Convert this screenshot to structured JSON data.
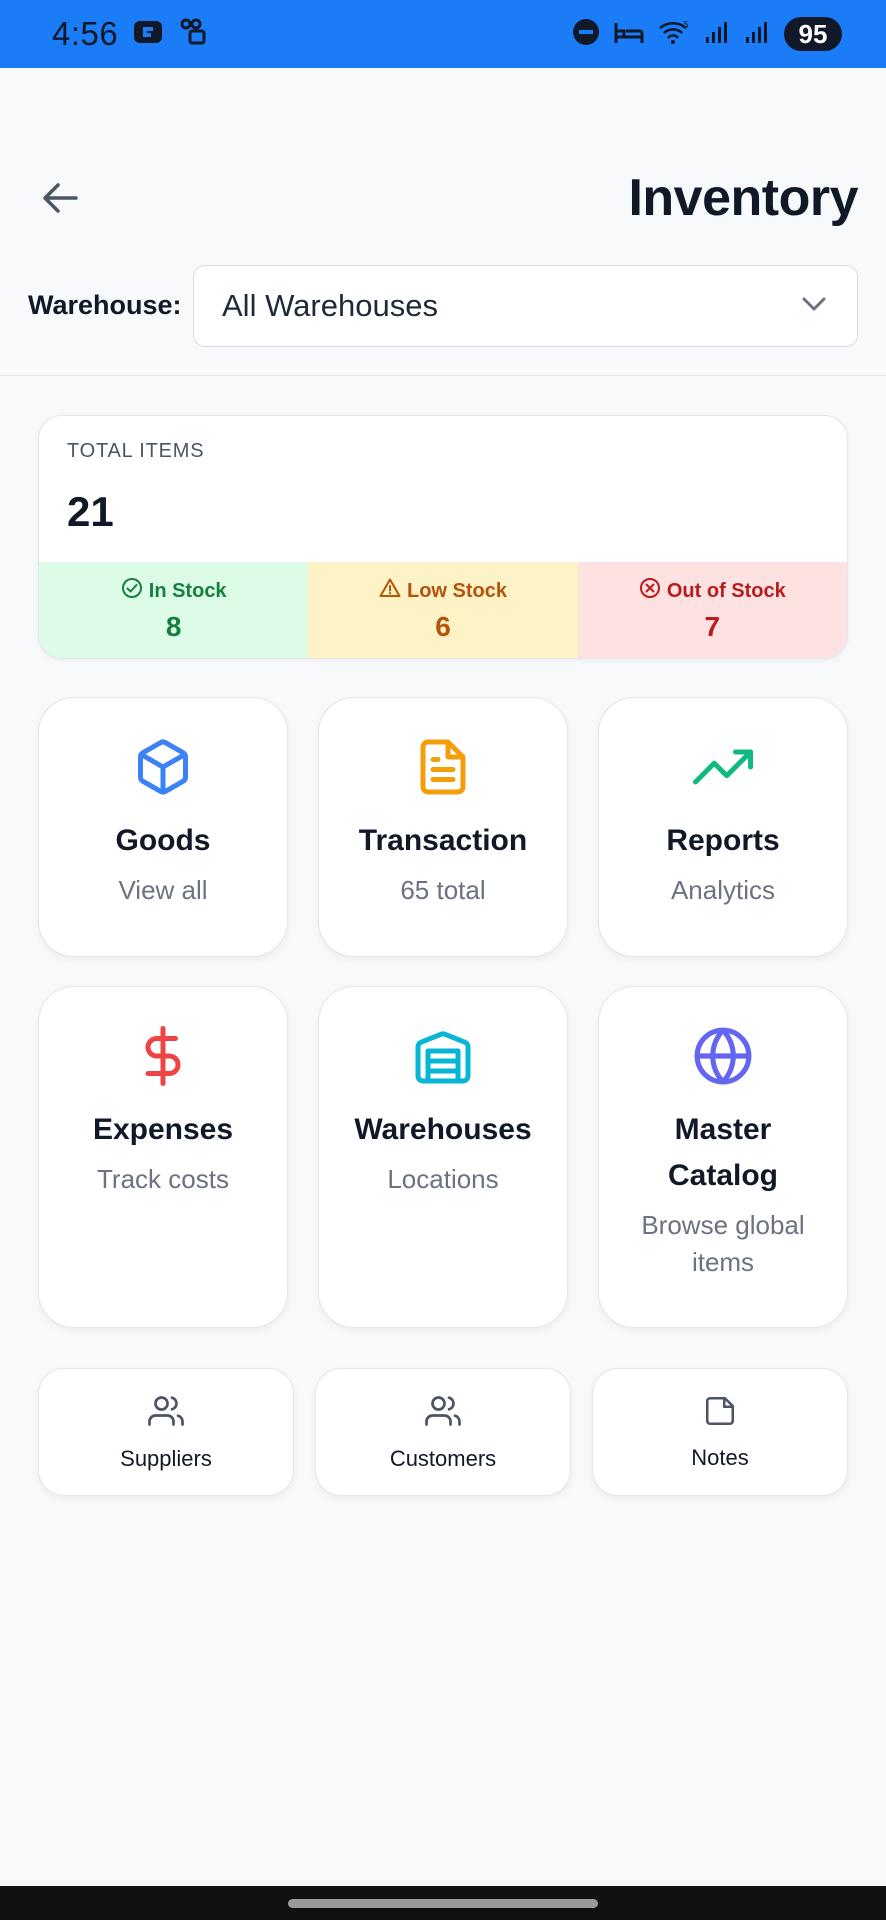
{
  "status_bar": {
    "time": "4:56",
    "battery": "95",
    "bg_color": "#1a7cf6"
  },
  "header": {
    "title": "Inventory",
    "back_icon": "arrow-left-icon",
    "warehouse_label": "Warehouse:",
    "warehouse_selected": "All Warehouses"
  },
  "summary": {
    "total_label": "TOTAL ITEMS",
    "total_value": "21",
    "in_stock": {
      "label": "In Stock",
      "count": "8",
      "color": "#15803d"
    },
    "low_stock": {
      "label": "Low Stock",
      "count": "6",
      "color": "#b45309"
    },
    "out_of_stock": {
      "label": "Out of Stock",
      "count": "7",
      "color": "#b91c1c"
    }
  },
  "tiles": [
    {
      "title": "Goods",
      "subtitle": "View all",
      "icon": "box-icon",
      "color": "#3b82f6"
    },
    {
      "title": "Transaction",
      "subtitle": "65 total",
      "icon": "document-icon",
      "color": "#f59e0b"
    },
    {
      "title": "Reports",
      "subtitle": "Analytics",
      "icon": "trending-up-icon",
      "color": "#10b981"
    },
    {
      "title": "Expenses",
      "subtitle": "Track costs",
      "icon": "dollar-icon",
      "color": "#ef4444"
    },
    {
      "title": "Warehouses",
      "subtitle": "Locations",
      "icon": "warehouse-icon",
      "color": "#06b6d4"
    },
    {
      "title": "Master Catalog",
      "subtitle": "Browse global items",
      "icon": "globe-icon",
      "color": "#6366f1"
    }
  ],
  "mini_tiles": [
    {
      "label": "Suppliers",
      "icon": "users-icon"
    },
    {
      "label": "Customers",
      "icon": "users-icon"
    },
    {
      "label": "Notes",
      "icon": "note-icon"
    }
  ]
}
